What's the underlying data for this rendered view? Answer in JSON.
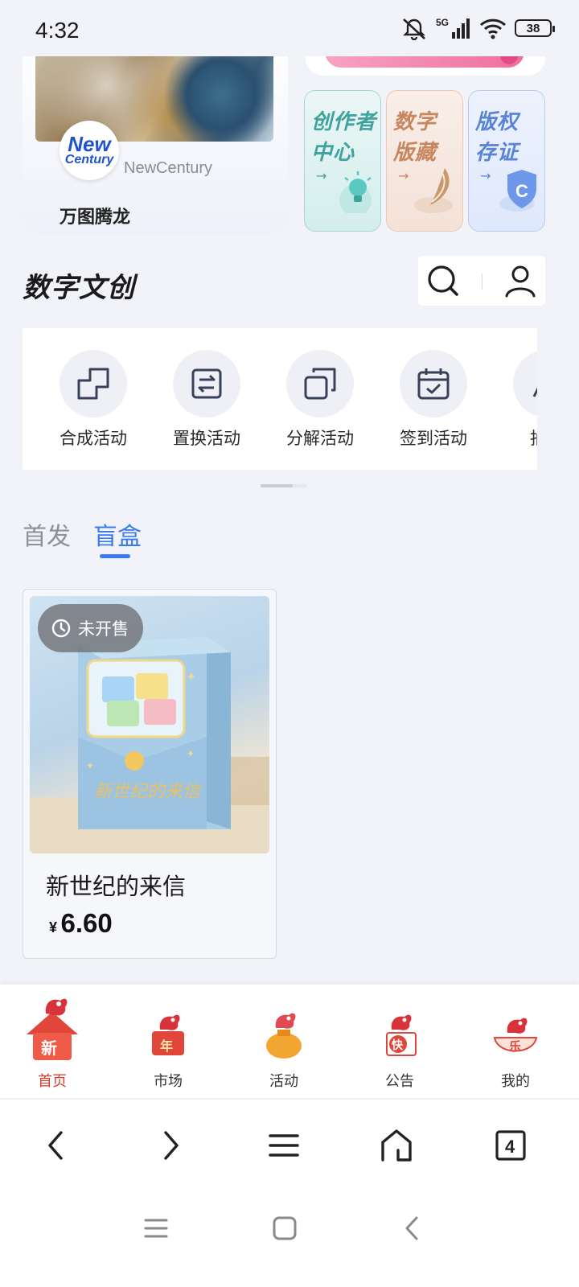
{
  "status_bar": {
    "time": "4:32",
    "network": "5G",
    "battery": "38"
  },
  "banner": {
    "brand_logo_line1": "New",
    "brand_logo_line2": "Century",
    "brand_name": "NewCentury",
    "title": "万图腾龙"
  },
  "feature_tiles": [
    {
      "line1": "创作者",
      "line2": "中心",
      "arrow": "→"
    },
    {
      "line1": "数字",
      "line2": "版藏",
      "arrow": "→"
    },
    {
      "line1": "版权",
      "line2": "存证",
      "arrow": "→"
    }
  ],
  "section": {
    "title": "数字文创"
  },
  "activities": [
    {
      "label": "合成活动",
      "icon": "merge-icon"
    },
    {
      "label": "置换活动",
      "icon": "exchange-icon"
    },
    {
      "label": "分解活动",
      "icon": "split-icon"
    },
    {
      "label": "签到活动",
      "icon": "calendar-check-icon"
    },
    {
      "label": "抽奖",
      "icon": "lottery-icon"
    }
  ],
  "tabs": [
    {
      "label": "首发",
      "active": false
    },
    {
      "label": "盲盒",
      "active": true
    }
  ],
  "products": [
    {
      "status": "未开售",
      "name": "新世纪的来信",
      "currency": "¥",
      "price": "6.60"
    }
  ],
  "bottom_nav": [
    {
      "label": "首页",
      "badge": "新",
      "active": true
    },
    {
      "label": "市场",
      "badge": "年",
      "active": false
    },
    {
      "label": "活动",
      "badge": "",
      "active": false
    },
    {
      "label": "公告",
      "badge": "快",
      "active": false
    },
    {
      "label": "我的",
      "badge": "乐",
      "active": false
    }
  ],
  "browser": {
    "tab_count": "4"
  },
  "colors": {
    "accent": "#3b7bf0",
    "active_nav": "#d93a2b",
    "background": "#f1f3f8"
  }
}
